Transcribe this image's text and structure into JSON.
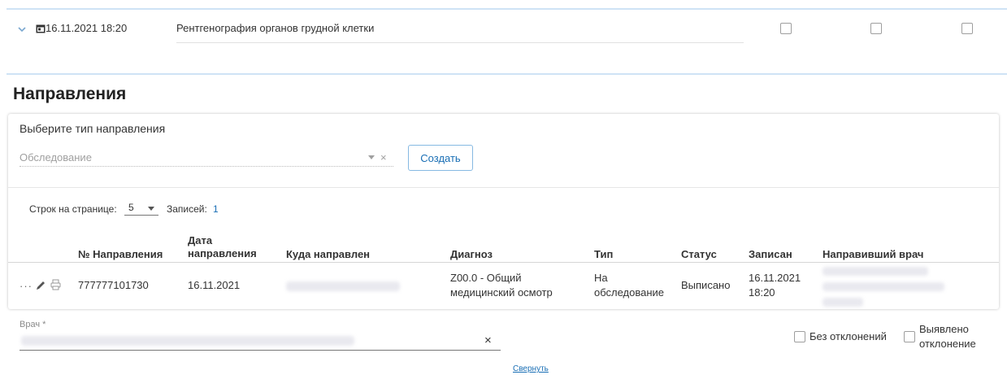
{
  "exam": {
    "datetime": "16.11.2021 18:20",
    "name": "Рентгенография органов грудной клетки"
  },
  "section": {
    "title": "Направления"
  },
  "referral_form": {
    "choose_label": "Выберите тип направления",
    "type_placeholder": "Обследование",
    "clear_icon": "×",
    "create_label": "Создать"
  },
  "pagination": {
    "rows_label": "Строк на странице:",
    "rows_value": "5",
    "records_label": "Записей:",
    "records_value": "1"
  },
  "table": {
    "headers": {
      "number": "№ Направления",
      "date_line1": "Дата",
      "date_line2": "направления",
      "destination": "Куда направлен",
      "diagnosis": "Диагноз",
      "type": "Тип",
      "status": "Статус",
      "scheduled": "Записан",
      "doctor": "Направивший врач"
    },
    "rows": [
      {
        "actions_more": "···",
        "number": "777777101730",
        "date": "16.11.2021",
        "diagnosis_line1": "Z00.0 - Общий",
        "diagnosis_line2": "медицинский осмотр",
        "type_line1": "На",
        "type_line2": "обследование",
        "status": "Выписано",
        "scheduled_line1": "16.11.2021",
        "scheduled_line2": "18:20"
      }
    ]
  },
  "doctor_field": {
    "label": "Врач *",
    "clear_icon": "×"
  },
  "checks": {
    "no_deviation": "Без отклонений",
    "deviation_line1": "Выявлено",
    "deviation_line2": "отклонение"
  },
  "collapse_link": "Свернуть",
  "icons": {
    "chevron": "chevron-down-icon",
    "calendar": "calendar-icon",
    "edit": "pencil-icon",
    "print": "printer-icon"
  },
  "colors": {
    "accent": "#1a6fb5",
    "card_border": "#cfe3f5"
  }
}
